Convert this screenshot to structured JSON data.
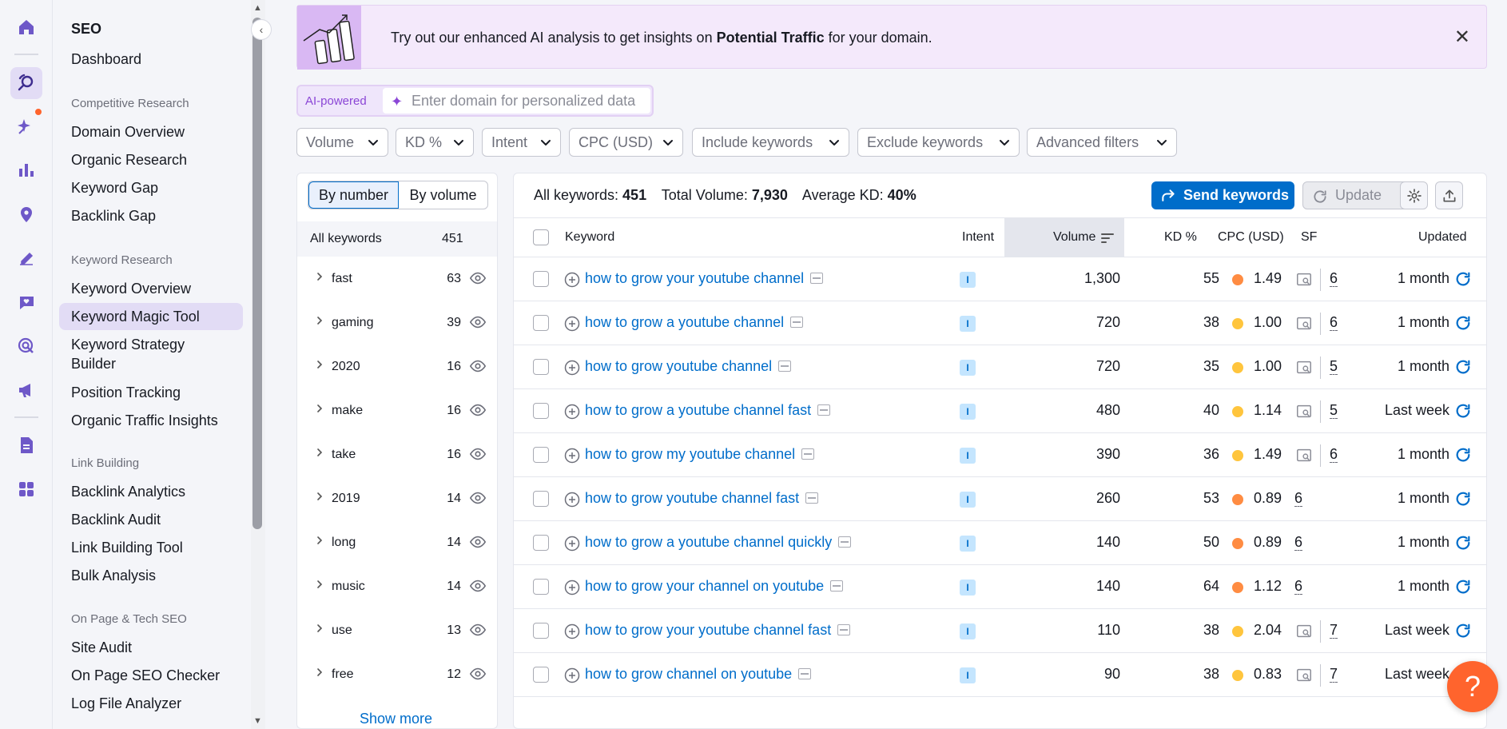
{
  "colors": {
    "accent": "#006dca",
    "brand": "#ff642d",
    "kd_orange": "#ff8c42",
    "kd_yellow": "#ffc53d",
    "ai_purple": "#8b46d6"
  },
  "rail": [
    {
      "name": "home-icon"
    },
    {
      "name": "seo-toolkit-icon",
      "active": true
    },
    {
      "name": "ai-sparkle-icon",
      "badge": true
    },
    {
      "name": "bar-chart-icon"
    },
    {
      "name": "location-pin-icon"
    },
    {
      "name": "content-pen-icon"
    },
    {
      "name": "chat-heart-icon"
    },
    {
      "name": "target-click-icon"
    },
    {
      "name": "megaphone-icon"
    },
    {
      "name": "document-icon"
    },
    {
      "name": "apps-grid-icon"
    }
  ],
  "nav": {
    "title": "SEO",
    "dashboard": "Dashboard",
    "sections": [
      {
        "label": "Competitive Research",
        "items": [
          "Domain Overview",
          "Organic Research",
          "Keyword Gap",
          "Backlink Gap"
        ]
      },
      {
        "label": "Keyword Research",
        "items": [
          "Keyword Overview",
          "Keyword Magic Tool",
          "Keyword Strategy Builder",
          "Position Tracking",
          "Organic Traffic Insights"
        ]
      },
      {
        "label": "Link Building",
        "items": [
          "Backlink Analytics",
          "Backlink Audit",
          "Link Building Tool",
          "Bulk Analysis"
        ]
      },
      {
        "label": "On Page & Tech SEO",
        "items": [
          "Site Audit",
          "On Page SEO Checker",
          "Log File Analyzer"
        ]
      }
    ],
    "active_item": "Keyword Magic Tool"
  },
  "banner": {
    "text_before": "Try out our enhanced AI analysis to get insights on ",
    "text_bold": "Potential Traffic",
    "text_after": " for your domain."
  },
  "ai": {
    "label": "AI-powered",
    "placeholder": "Enter domain for personalized data"
  },
  "filters": [
    "Volume",
    "KD %",
    "Intent",
    "CPC (USD)",
    "Include keywords",
    "Exclude keywords",
    "Advanced filters"
  ],
  "groups": {
    "toggle": [
      "By number",
      "By volume"
    ],
    "all_label": "All keywords",
    "all_count": "451",
    "items": [
      {
        "label": "fast",
        "count": "63"
      },
      {
        "label": "gaming",
        "count": "39"
      },
      {
        "label": "2020",
        "count": "16"
      },
      {
        "label": "make",
        "count": "16"
      },
      {
        "label": "take",
        "count": "16"
      },
      {
        "label": "2019",
        "count": "14"
      },
      {
        "label": "long",
        "count": "14"
      },
      {
        "label": "music",
        "count": "14"
      },
      {
        "label": "use",
        "count": "13"
      },
      {
        "label": "free",
        "count": "12"
      }
    ],
    "show_more": "Show more"
  },
  "summary": {
    "all_label": "All keywords:",
    "all_value": "451",
    "vol_label": "Total Volume:",
    "vol_value": "7,930",
    "kd_label": "Average KD:",
    "kd_value": "40%"
  },
  "buttons": {
    "send": "Send keywords",
    "update": "Update"
  },
  "columns": {
    "keyword": "Keyword",
    "intent": "Intent",
    "volume": "Volume",
    "kd": "KD %",
    "cpc": "CPC (USD)",
    "sf": "SF",
    "updated": "Updated"
  },
  "rows": [
    {
      "keyword": "how to grow your youtube channel",
      "intent": "I",
      "volume": "1,300",
      "kd": "55",
      "kd_level": "orange",
      "cpc": "1.49",
      "sf_icon": true,
      "sf": "6",
      "updated": "1 month"
    },
    {
      "keyword": "how to grow a youtube channel",
      "intent": "I",
      "volume": "720",
      "kd": "38",
      "kd_level": "yellow",
      "cpc": "1.00",
      "sf_icon": true,
      "sf": "6",
      "updated": "1 month"
    },
    {
      "keyword": "how to grow youtube channel",
      "intent": "I",
      "volume": "720",
      "kd": "35",
      "kd_level": "yellow",
      "cpc": "1.00",
      "sf_icon": true,
      "sf": "5",
      "updated": "1 month"
    },
    {
      "keyword": "how to grow a youtube channel fast",
      "intent": "I",
      "volume": "480",
      "kd": "40",
      "kd_level": "yellow",
      "cpc": "1.14",
      "sf_icon": true,
      "sf": "5",
      "updated": "Last week"
    },
    {
      "keyword": "how to grow my youtube channel",
      "intent": "I",
      "volume": "390",
      "kd": "36",
      "kd_level": "yellow",
      "cpc": "1.49",
      "sf_icon": true,
      "sf": "6",
      "updated": "1 month"
    },
    {
      "keyword": "how to grow youtube channel fast",
      "intent": "I",
      "volume": "260",
      "kd": "53",
      "kd_level": "orange",
      "cpc": "0.89",
      "sf_icon": false,
      "sf": "6",
      "updated": "1 month"
    },
    {
      "keyword": "how to grow a youtube channel quickly",
      "intent": "I",
      "volume": "140",
      "kd": "50",
      "kd_level": "orange",
      "cpc": "0.89",
      "sf_icon": false,
      "sf": "6",
      "updated": "1 month"
    },
    {
      "keyword": "how to grow your channel on youtube",
      "intent": "I",
      "volume": "140",
      "kd": "64",
      "kd_level": "orange",
      "cpc": "1.12",
      "sf_icon": false,
      "sf": "6",
      "updated": "1 month"
    },
    {
      "keyword": "how to grow your youtube channel fast",
      "intent": "I",
      "volume": "110",
      "kd": "38",
      "kd_level": "yellow",
      "cpc": "2.04",
      "sf_icon": true,
      "sf": "7",
      "updated": "Last week"
    },
    {
      "keyword": "how to grow channel on youtube",
      "intent": "I",
      "volume": "90",
      "kd": "38",
      "kd_level": "yellow",
      "cpc": "0.83",
      "sf_icon": true,
      "sf": "7",
      "updated": "Last week"
    }
  ],
  "help_label": "?"
}
